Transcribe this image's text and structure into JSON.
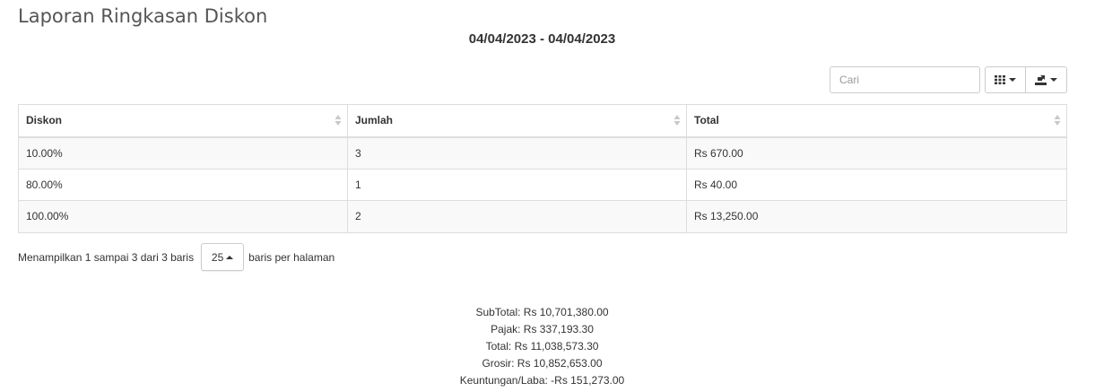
{
  "page": {
    "title": "Laporan Ringkasan Diskon",
    "date_range": "04/04/2023 - 04/04/2023"
  },
  "toolbar": {
    "search_placeholder": "Cari",
    "columns_icon": "grid-icon",
    "export_icon": "export-icon"
  },
  "table": {
    "columns": [
      "Diskon",
      "Jumlah",
      "Total"
    ],
    "rows": [
      [
        "10.00%",
        "3",
        "Rs 670.00"
      ],
      [
        "80.00%",
        "1",
        "Rs 40.00"
      ],
      [
        "100.00%",
        "2",
        "Rs 13,250.00"
      ]
    ]
  },
  "pagination": {
    "info": "Menampilkan 1 sampai 3 dari 3 baris",
    "page_size": "25",
    "per_page_label": "baris per halaman"
  },
  "summary": {
    "subtotal": "SubTotal: Rs 10,701,380.00",
    "tax": "Pajak: Rs 337,193.30",
    "total": "Total: Rs 11,038,573.30",
    "wholesale": "Grosir: Rs 10,852,653.00",
    "profit": "Keuntungan/Laba: -Rs 151,273.00"
  }
}
